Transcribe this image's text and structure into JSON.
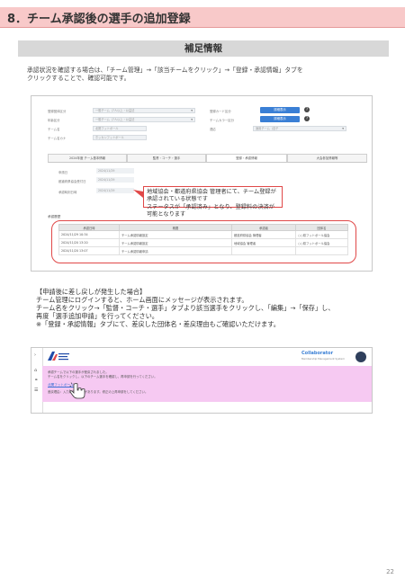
{
  "header": {
    "title": "8．チーム承認後の選手の追加登録"
  },
  "section": {
    "title": "補足情報"
  },
  "intro": {
    "line1": "承認状況を確認する場合は、「チーム管理」→「該当チームをクリック」→「登録・承認情報」タブを",
    "line2": "クリックすることで、確認可能です。"
  },
  "shot1": {
    "form_left": [
      {
        "label": "登録団体区分",
        "value": "一般チーム（7人以上・公益法"
      },
      {
        "label": "年齢区分",
        "value": "一般チーム（7人以上・公益法"
      },
      {
        "label": "チーム名",
        "value": "北関フットボール"
      },
      {
        "label": "チーム名カナ",
        "value": "ホッカンフットボール"
      }
    ],
    "form_right": [
      {
        "label": "登録カード区分",
        "button": "詳細表示"
      },
      {
        "label": "チームカラー区分",
        "button": "詳細表示"
      },
      {
        "label": "適応",
        "value": "適用チーム（自チ"
      }
    ],
    "tabs": [
      "2024年度 チーム基本情報",
      "監督・コーチ・選手",
      "登録・承認情報",
      "大会参加情報等"
    ],
    "info": [
      {
        "label": "申請日",
        "value": "2024/11/29"
      },
      {
        "label": "都道府県協会受付日",
        "value": "2024/11/29"
      },
      {
        "label": "承認時刻日時",
        "value": "2024/11/29"
      }
    ],
    "callout": {
      "line1": "地域協会・都道府県協会 管理者にて、チーム登録が承認されている状態です",
      "line2": "ステータスが「承認済み」となり、登録料の決済が可能となります"
    },
    "history_label": "承認履歴",
    "table": {
      "headers": [
        "承認日時",
        "概要",
        "承認者",
        "団体名"
      ],
      "rows": [
        [
          "2024/11/29 10:34",
          "チーム承認情報設定",
          "都道府県協会 管理者",
          "○○県フットボール協会"
        ],
        [
          "2024/11/20 13:20",
          "チーム承認情報設定",
          "地域協会 管理者",
          "○○県フットボール協会"
        ],
        [
          "2024/11/20 13:07",
          "チーム承認情報申請",
          "",
          ""
        ]
      ]
    }
  },
  "notes": {
    "heading": "【申請後に差し戻しが発生した場合】",
    "line1": "チーム管理にログインすると、ホーム画面にメッセージが表示されます。",
    "line2": "チーム名をクリック→「監督・コーチ・選手」タブより該当選手をクリックし、「編集」→「保存」し、",
    "line3": "再度「選手追加申請」を行ってください。",
    "line4": "※「登録・承認情報」タブにて、差戻した団体名・差戻理由もご確認いただけます。"
  },
  "shot2": {
    "brand": "Collaborator",
    "brand_sub": "Membership Management System",
    "message1": "承認チームで以下の選手が差戻されました。",
    "message2": "チーム名をクリックし、以下のチーム選手を確認し、再申請を行ってください。",
    "link": "北関フットボール",
    "message3": "差戻理由：入力内容に誤りがあります。修正の上再申請をしてください。",
    "side_icons": [
      "›",
      "⌂",
      "⚭",
      "☰"
    ]
  },
  "page_number": "22",
  "colors": {
    "header_bg": "#f8c9c9",
    "section_bg": "#d8d8d8",
    "accent_red": "#e04848",
    "pink_band": "#f6c9f2",
    "blue": "#3a7fd5"
  }
}
